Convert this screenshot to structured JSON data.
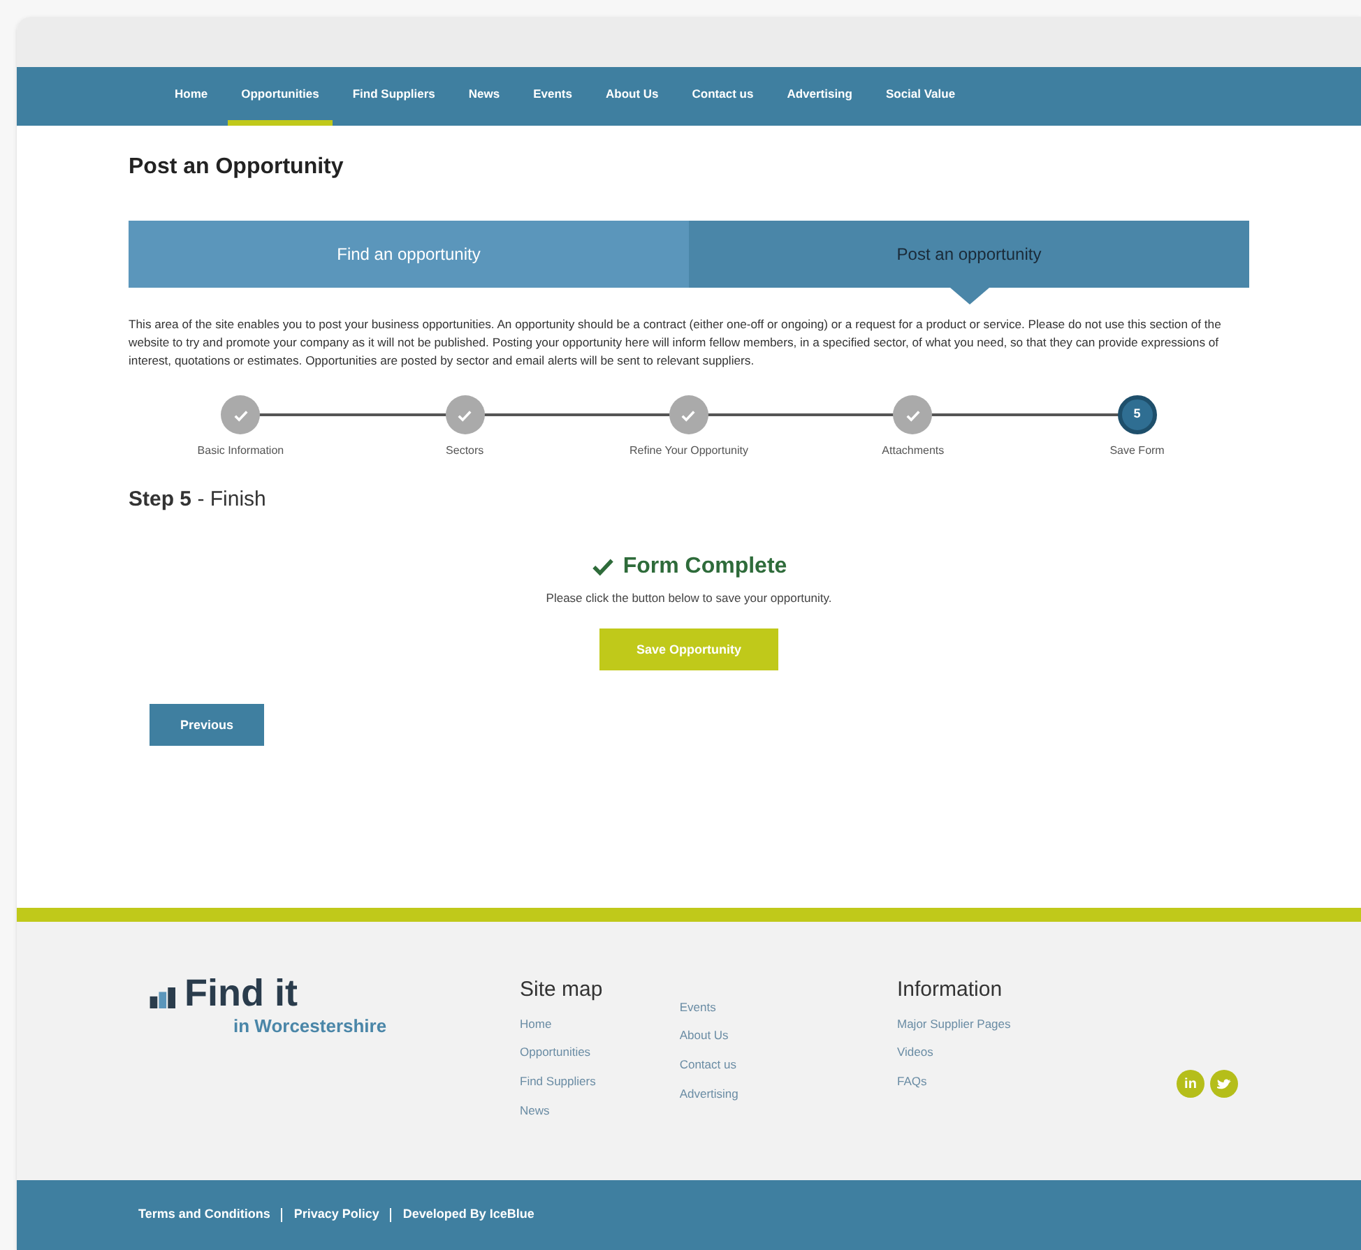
{
  "nav": {
    "items": [
      {
        "label": "Home",
        "selected": false
      },
      {
        "label": "Opportunities",
        "selected": true
      },
      {
        "label": "Find Suppliers",
        "selected": false
      },
      {
        "label": "News",
        "selected": false
      },
      {
        "label": "Events",
        "selected": false
      },
      {
        "label": "About Us",
        "selected": false
      },
      {
        "label": "Contact us",
        "selected": false
      },
      {
        "label": "Advertising",
        "selected": false
      },
      {
        "label": "Social Value",
        "selected": false
      }
    ]
  },
  "page_title": "Post an Opportunity",
  "tabs": [
    {
      "label": "Find an opportunity",
      "selected": false
    },
    {
      "label": "Post an opportunity",
      "selected": true
    }
  ],
  "intro": "This area of the site enables you to post your business opportunities. An opportunity should be a contract (either one-off or ongoing) or a request for a product or service. Please do not use this section of the website to try and promote your company as it will not be published. Posting your opportunity here will inform fellow members, in a specified sector, of what you need, so that they can provide expressions of interest, quotations or estimates. Opportunities are posted by sector and email alerts will be sent to relevant suppliers.",
  "steps": [
    {
      "label": "Basic Information",
      "kind": "done"
    },
    {
      "label": "Sectors",
      "kind": "done"
    },
    {
      "label": "Refine Your Opportunity",
      "kind": "done"
    },
    {
      "label": "Attachments",
      "kind": "done"
    },
    {
      "label": "Save Form",
      "kind": "current",
      "number": "5"
    }
  ],
  "step_heading": {
    "step": "Step 5",
    "name": "- Finish"
  },
  "complete": {
    "title": "Form Complete",
    "message": "Please click the button below to save your opportunity.",
    "button": "Save Opportunity"
  },
  "previous_button": "Previous",
  "footer": {
    "logo": {
      "name": "Find it",
      "tagline": "in Worcestershire"
    },
    "site_map": {
      "title": "Site map",
      "columns": [
        [
          "Home",
          "Opportunities",
          "Find Suppliers",
          "News"
        ],
        [
          "Events",
          "About Us",
          "Contact us",
          "Advertising"
        ]
      ]
    },
    "information": {
      "title": "Information",
      "links": [
        "Major Supplier Pages",
        "Videos",
        "FAQs"
      ]
    },
    "social": [
      {
        "kind": "linkedin",
        "label": "in"
      },
      {
        "kind": "twitter"
      }
    ]
  },
  "bottom_links": [
    "Terms and Conditions",
    "Privacy Policy",
    "Developed By IceBlue"
  ]
}
